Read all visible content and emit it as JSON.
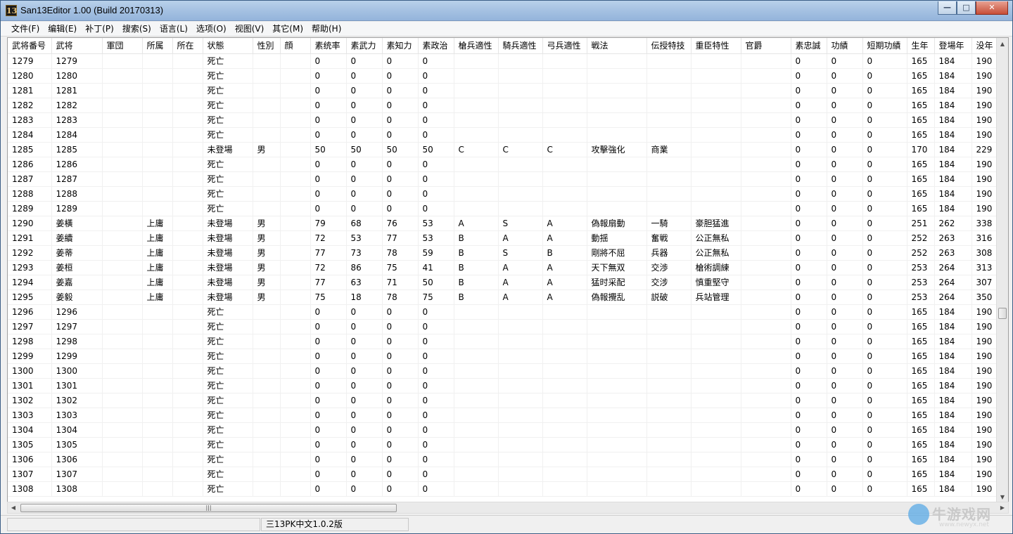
{
  "window": {
    "icon_text": "13",
    "title": "San13Editor 1.00 (Build 20170313)",
    "controls": {
      "minimize": "—",
      "maximize": "□",
      "close": "✕"
    }
  },
  "menu": [
    "文件(F)",
    "编辑(E)",
    "补丁(P)",
    "搜索(S)",
    "语言(L)",
    "选项(O)",
    "视图(V)",
    "其它(M)",
    "帮助(H)"
  ],
  "table": {
    "columns": [
      "武将番号",
      "武将",
      "軍団",
      "所属",
      "所在",
      "状態",
      "性別",
      "顔",
      "素统率",
      "素武力",
      "素知力",
      "素政治",
      "槍兵適性",
      "騎兵適性",
      "弓兵適性",
      "戦法",
      "伝授特技",
      "重臣特性",
      "官爵",
      "素忠誠",
      "功績",
      "短期功績",
      "生年",
      "登場年",
      "没年"
    ],
    "rows": [
      [
        "1279",
        "1279",
        "",
        "",
        "",
        "死亡",
        "",
        "",
        "0",
        "0",
        "0",
        "0",
        "",
        "",
        "",
        "",
        "",
        "",
        "",
        "0",
        "0",
        "0",
        "165",
        "184",
        "190"
      ],
      [
        "1280",
        "1280",
        "",
        "",
        "",
        "死亡",
        "",
        "",
        "0",
        "0",
        "0",
        "0",
        "",
        "",
        "",
        "",
        "",
        "",
        "",
        "0",
        "0",
        "0",
        "165",
        "184",
        "190"
      ],
      [
        "1281",
        "1281",
        "",
        "",
        "",
        "死亡",
        "",
        "",
        "0",
        "0",
        "0",
        "0",
        "",
        "",
        "",
        "",
        "",
        "",
        "",
        "0",
        "0",
        "0",
        "165",
        "184",
        "190"
      ],
      [
        "1282",
        "1282",
        "",
        "",
        "",
        "死亡",
        "",
        "",
        "0",
        "0",
        "0",
        "0",
        "",
        "",
        "",
        "",
        "",
        "",
        "",
        "0",
        "0",
        "0",
        "165",
        "184",
        "190"
      ],
      [
        "1283",
        "1283",
        "",
        "",
        "",
        "死亡",
        "",
        "",
        "0",
        "0",
        "0",
        "0",
        "",
        "",
        "",
        "",
        "",
        "",
        "",
        "0",
        "0",
        "0",
        "165",
        "184",
        "190"
      ],
      [
        "1284",
        "1284",
        "",
        "",
        "",
        "死亡",
        "",
        "",
        "0",
        "0",
        "0",
        "0",
        "",
        "",
        "",
        "",
        "",
        "",
        "",
        "0",
        "0",
        "0",
        "165",
        "184",
        "190"
      ],
      [
        "1285",
        "1285",
        "",
        "",
        "",
        "未登場",
        "男",
        "",
        "50",
        "50",
        "50",
        "50",
        "C",
        "C",
        "C",
        "攻擊強化",
        "商業",
        "",
        "",
        "0",
        "0",
        "0",
        "170",
        "184",
        "229"
      ],
      [
        "1286",
        "1286",
        "",
        "",
        "",
        "死亡",
        "",
        "",
        "0",
        "0",
        "0",
        "0",
        "",
        "",
        "",
        "",
        "",
        "",
        "",
        "0",
        "0",
        "0",
        "165",
        "184",
        "190"
      ],
      [
        "1287",
        "1287",
        "",
        "",
        "",
        "死亡",
        "",
        "",
        "0",
        "0",
        "0",
        "0",
        "",
        "",
        "",
        "",
        "",
        "",
        "",
        "0",
        "0",
        "0",
        "165",
        "184",
        "190"
      ],
      [
        "1288",
        "1288",
        "",
        "",
        "",
        "死亡",
        "",
        "",
        "0",
        "0",
        "0",
        "0",
        "",
        "",
        "",
        "",
        "",
        "",
        "",
        "0",
        "0",
        "0",
        "165",
        "184",
        "190"
      ],
      [
        "1289",
        "1289",
        "",
        "",
        "",
        "死亡",
        "",
        "",
        "0",
        "0",
        "0",
        "0",
        "",
        "",
        "",
        "",
        "",
        "",
        "",
        "0",
        "0",
        "0",
        "165",
        "184",
        "190"
      ],
      [
        "1290",
        "姜橫",
        "",
        "上庸",
        "",
        "未登場",
        "男",
        "",
        "79",
        "68",
        "76",
        "53",
        "A",
        "S",
        "A",
        "偽報扇動",
        "一騎",
        "豪胆猛進",
        "",
        "0",
        "0",
        "0",
        "251",
        "262",
        "338"
      ],
      [
        "1291",
        "姜續",
        "",
        "上庸",
        "",
        "未登場",
        "男",
        "",
        "72",
        "53",
        "77",
        "53",
        "B",
        "A",
        "A",
        "動揺",
        "奮戦",
        "公正無私",
        "",
        "0",
        "0",
        "0",
        "252",
        "263",
        "316"
      ],
      [
        "1292",
        "姜蒂",
        "",
        "上庸",
        "",
        "未登場",
        "男",
        "",
        "77",
        "73",
        "78",
        "59",
        "B",
        "S",
        "B",
        "剛將不屈",
        "兵器",
        "公正無私",
        "",
        "0",
        "0",
        "0",
        "252",
        "263",
        "308"
      ],
      [
        "1293",
        "姜桓",
        "",
        "上庸",
        "",
        "未登場",
        "男",
        "",
        "72",
        "86",
        "75",
        "41",
        "B",
        "A",
        "A",
        "天下無双",
        "交渉",
        "槍術調練",
        "",
        "0",
        "0",
        "0",
        "253",
        "264",
        "313"
      ],
      [
        "1294",
        "姜嘉",
        "",
        "上庸",
        "",
        "未登場",
        "男",
        "",
        "77",
        "63",
        "71",
        "50",
        "B",
        "A",
        "A",
        "猛时采配",
        "交涉",
        "慎重堅守",
        "",
        "0",
        "0",
        "0",
        "253",
        "264",
        "307"
      ],
      [
        "1295",
        "姜毅",
        "",
        "上庸",
        "",
        "未登場",
        "男",
        "",
        "75",
        "18",
        "78",
        "75",
        "B",
        "A",
        "A",
        "偽報攪乱",
        "説破",
        "兵站管理",
        "",
        "0",
        "0",
        "0",
        "253",
        "264",
        "350"
      ],
      [
        "1296",
        "1296",
        "",
        "",
        "",
        "死亡",
        "",
        "",
        "0",
        "0",
        "0",
        "0",
        "",
        "",
        "",
        "",
        "",
        "",
        "",
        "0",
        "0",
        "0",
        "165",
        "184",
        "190"
      ],
      [
        "1297",
        "1297",
        "",
        "",
        "",
        "死亡",
        "",
        "",
        "0",
        "0",
        "0",
        "0",
        "",
        "",
        "",
        "",
        "",
        "",
        "",
        "0",
        "0",
        "0",
        "165",
        "184",
        "190"
      ],
      [
        "1298",
        "1298",
        "",
        "",
        "",
        "死亡",
        "",
        "",
        "0",
        "0",
        "0",
        "0",
        "",
        "",
        "",
        "",
        "",
        "",
        "",
        "0",
        "0",
        "0",
        "165",
        "184",
        "190"
      ],
      [
        "1299",
        "1299",
        "",
        "",
        "",
        "死亡",
        "",
        "",
        "0",
        "0",
        "0",
        "0",
        "",
        "",
        "",
        "",
        "",
        "",
        "",
        "0",
        "0",
        "0",
        "165",
        "184",
        "190"
      ],
      [
        "1300",
        "1300",
        "",
        "",
        "",
        "死亡",
        "",
        "",
        "0",
        "0",
        "0",
        "0",
        "",
        "",
        "",
        "",
        "",
        "",
        "",
        "0",
        "0",
        "0",
        "165",
        "184",
        "190"
      ],
      [
        "1301",
        "1301",
        "",
        "",
        "",
        "死亡",
        "",
        "",
        "0",
        "0",
        "0",
        "0",
        "",
        "",
        "",
        "",
        "",
        "",
        "",
        "0",
        "0",
        "0",
        "165",
        "184",
        "190"
      ],
      [
        "1302",
        "1302",
        "",
        "",
        "",
        "死亡",
        "",
        "",
        "0",
        "0",
        "0",
        "0",
        "",
        "",
        "",
        "",
        "",
        "",
        "",
        "0",
        "0",
        "0",
        "165",
        "184",
        "190"
      ],
      [
        "1303",
        "1303",
        "",
        "",
        "",
        "死亡",
        "",
        "",
        "0",
        "0",
        "0",
        "0",
        "",
        "",
        "",
        "",
        "",
        "",
        "",
        "0",
        "0",
        "0",
        "165",
        "184",
        "190"
      ],
      [
        "1304",
        "1304",
        "",
        "",
        "",
        "死亡",
        "",
        "",
        "0",
        "0",
        "0",
        "0",
        "",
        "",
        "",
        "",
        "",
        "",
        "",
        "0",
        "0",
        "0",
        "165",
        "184",
        "190"
      ],
      [
        "1305",
        "1305",
        "",
        "",
        "",
        "死亡",
        "",
        "",
        "0",
        "0",
        "0",
        "0",
        "",
        "",
        "",
        "",
        "",
        "",
        "",
        "0",
        "0",
        "0",
        "165",
        "184",
        "190"
      ],
      [
        "1306",
        "1306",
        "",
        "",
        "",
        "死亡",
        "",
        "",
        "0",
        "0",
        "0",
        "0",
        "",
        "",
        "",
        "",
        "",
        "",
        "",
        "0",
        "0",
        "0",
        "165",
        "184",
        "190"
      ],
      [
        "1307",
        "1307",
        "",
        "",
        "",
        "死亡",
        "",
        "",
        "0",
        "0",
        "0",
        "0",
        "",
        "",
        "",
        "",
        "",
        "",
        "",
        "0",
        "0",
        "0",
        "165",
        "184",
        "190"
      ],
      [
        "1308",
        "1308",
        "",
        "",
        "",
        "死亡",
        "",
        "",
        "0",
        "0",
        "0",
        "0",
        "",
        "",
        "",
        "",
        "",
        "",
        "",
        "0",
        "0",
        "0",
        "165",
        "184",
        "190"
      ]
    ]
  },
  "scrollbars": {
    "up": "▲",
    "down": "▼",
    "left": "◀",
    "right": "▶",
    "grip": "|||"
  },
  "status": {
    "pane1": "",
    "pane2": "三13PK中文1.0.2版"
  },
  "watermark": {
    "text": "牛游戏网",
    "sub": "www.newyx.net"
  }
}
